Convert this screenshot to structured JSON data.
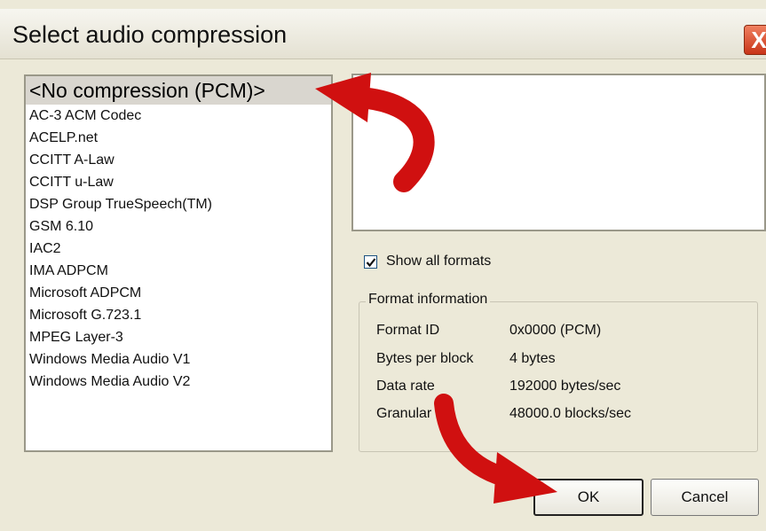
{
  "window": {
    "title": "Select audio compression",
    "close_label": "X"
  },
  "codec_list": {
    "selected": "<No compression (PCM)>",
    "items": [
      "<No compression (PCM)>",
      "AC-3 ACM Codec",
      "ACELP.net",
      "CCITT A-Law",
      "CCITT u-Law",
      "DSP Group TrueSpeech(TM)",
      "GSM 6.10",
      "IAC2",
      "IMA ADPCM",
      "Microsoft ADPCM",
      "Microsoft G.723.1",
      "MPEG Layer-3",
      "Windows Media Audio V1",
      "Windows Media Audio V2"
    ]
  },
  "show_all_formats": {
    "label": "Show all formats",
    "checked": true
  },
  "format_info": {
    "legend": "Format information",
    "rows": [
      {
        "label": "Format ID",
        "value": "0x0000 (PCM)"
      },
      {
        "label": "Bytes per block",
        "value": "4 bytes"
      },
      {
        "label": "Data rate",
        "value": "192000 bytes/sec"
      },
      {
        "label": "Granular",
        "value": "48000.0 blocks/sec"
      }
    ]
  },
  "buttons": {
    "ok": "OK",
    "cancel": "Cancel"
  },
  "colors": {
    "dialog_bg": "#ece9d8",
    "annotation_arrow": "#d01010",
    "selection_bg": "#d9d6cf"
  }
}
